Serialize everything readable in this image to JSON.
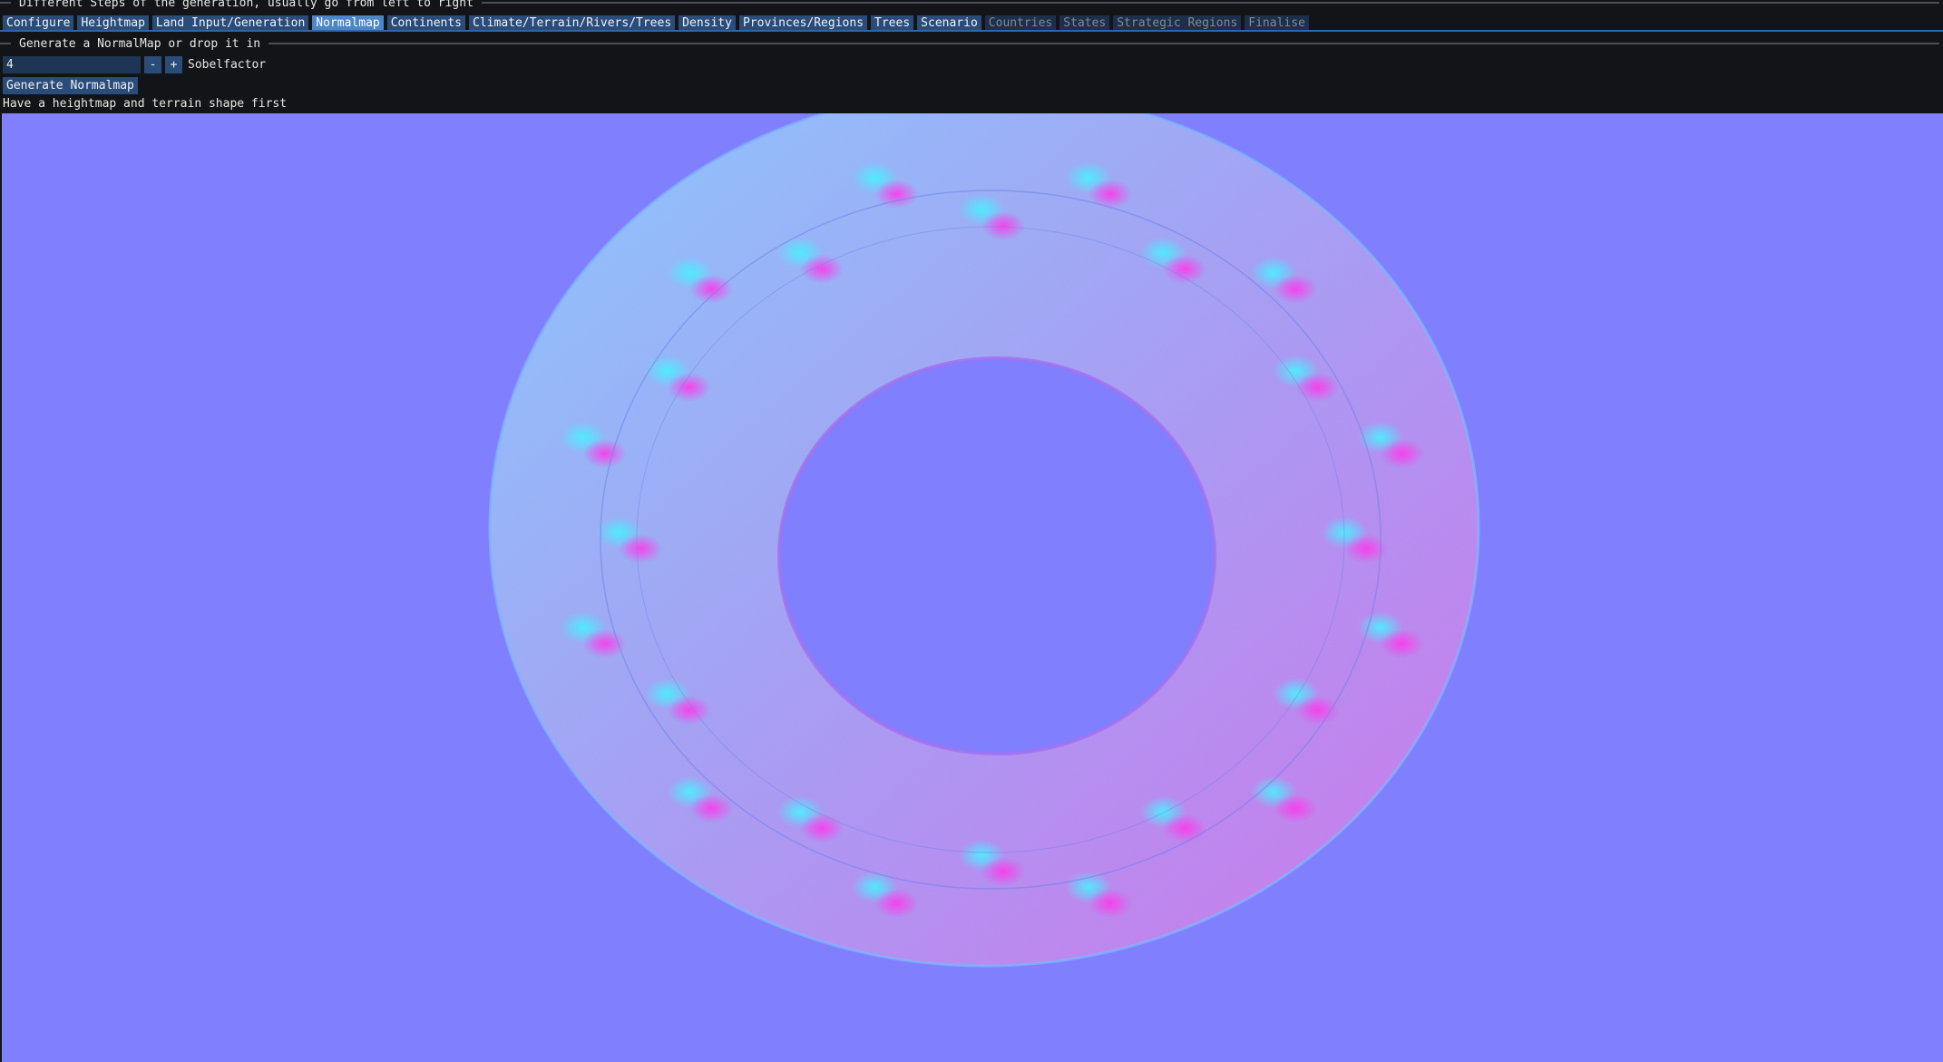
{
  "header": {
    "title": "Different Steps of the generation, usually go from left to right"
  },
  "tabs": [
    {
      "label": "Configure",
      "state": "normal"
    },
    {
      "label": "Heightmap",
      "state": "normal"
    },
    {
      "label": "Land Input/Generation",
      "state": "normal"
    },
    {
      "label": "Normalmap",
      "state": "active"
    },
    {
      "label": "Continents",
      "state": "normal"
    },
    {
      "label": "Climate/Terrain/Rivers/Trees",
      "state": "normal"
    },
    {
      "label": "Density",
      "state": "normal"
    },
    {
      "label": "Provinces/Regions",
      "state": "normal"
    },
    {
      "label": "Trees",
      "state": "normal"
    },
    {
      "label": "Scenario",
      "state": "normal"
    },
    {
      "label": "Countries",
      "state": "disabled"
    },
    {
      "label": "States",
      "state": "disabled"
    },
    {
      "label": "Strategic Regions",
      "state": "disabled"
    },
    {
      "label": "Finalise",
      "state": "disabled"
    }
  ],
  "normalmap": {
    "section_title": "Generate a NormalMap or drop it in",
    "sobel_value": "4",
    "minus_label": "-",
    "plus_label": "+",
    "sobel_label": "Sobelfactor",
    "generate_button": "Generate Normalmap",
    "hint": "Have a heightmap and terrain shape first"
  },
  "colors": {
    "normal_flat": "#8080ff",
    "tab_active": "#4a86c8",
    "tab_normal": "#2b4c79",
    "tab_disabled": "#1d2f49"
  }
}
